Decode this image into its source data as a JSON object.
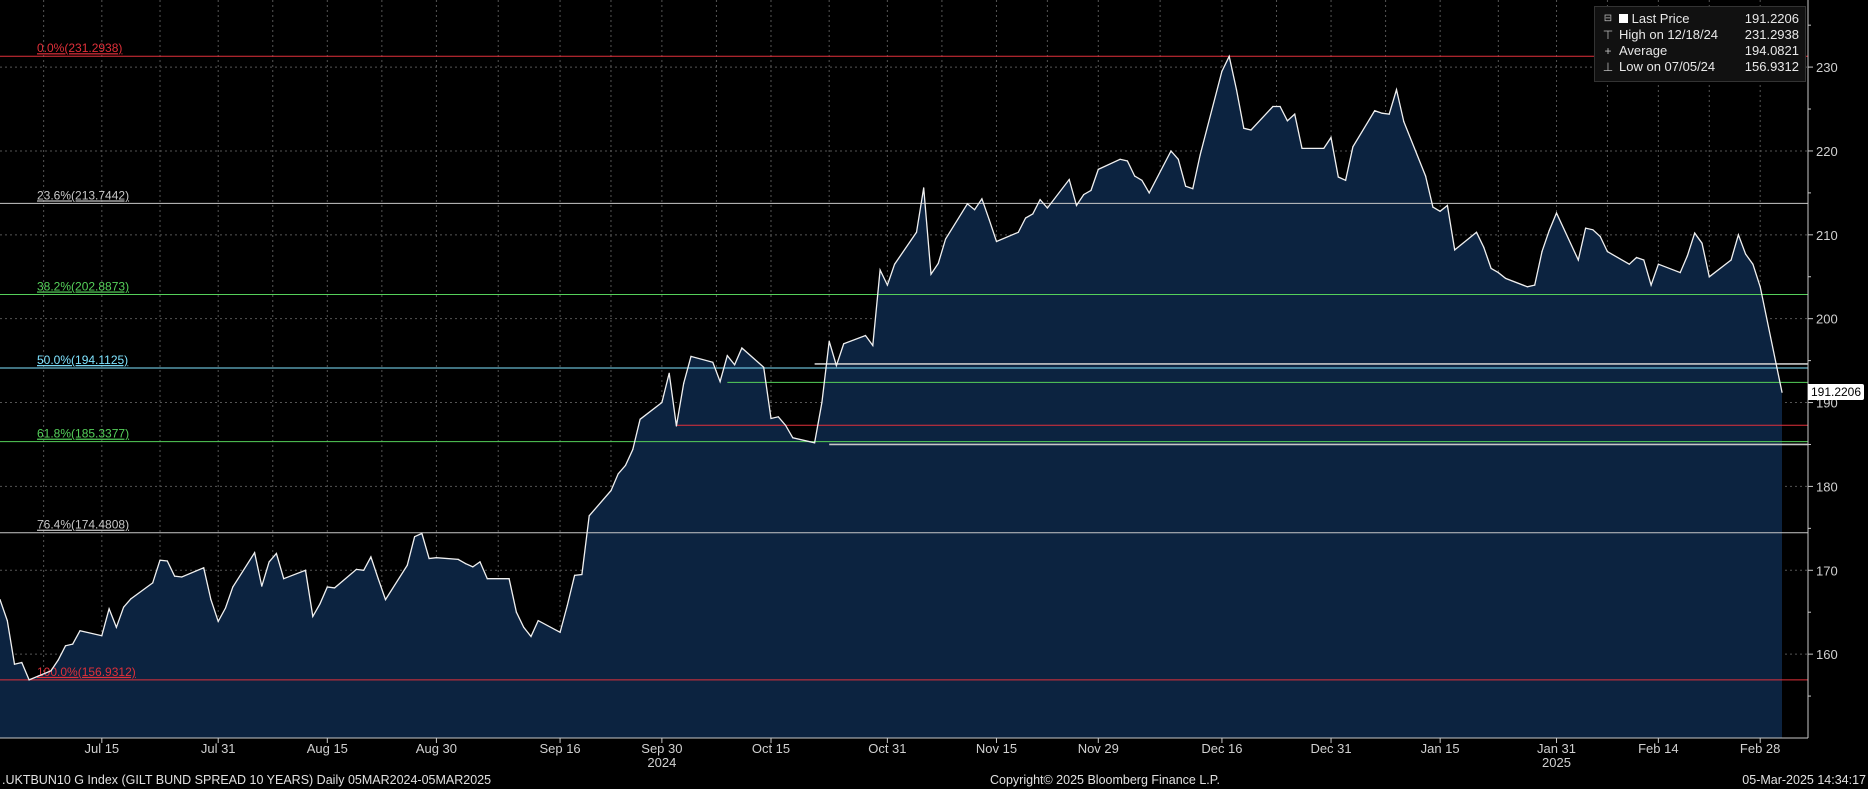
{
  "legend": {
    "items": [
      {
        "label": "Last Price",
        "value": "191.2206",
        "symbol": ""
      },
      {
        "label": "High on 12/18/24",
        "value": "231.2938",
        "symbol": "⊤"
      },
      {
        "label": "Average",
        "value": "194.0821",
        "symbol": "+"
      },
      {
        "label": "Low on 07/05/24",
        "value": "156.9312",
        "symbol": "⊥"
      }
    ]
  },
  "last_price_tag": "191.2206",
  "footer": {
    "left": ".UKTBUN10 G Index (GILT BUND SPREAD 10 YEARS)  Daily 05MAR2024-05MAR2025",
    "center": "Copyright© 2025 Bloomberg Finance L.P.",
    "right": "05-Mar-2025 14:34:17"
  },
  "colors": {
    "background": "#000000",
    "area_fill": "#0c2340",
    "line": "#ffffff",
    "grid": "#555555",
    "fib_red": "#e0303a",
    "fib_white": "#c8c8c8",
    "fib_green": "#55d05a",
    "fib_cyan": "#7fe3ff"
  },
  "chart_data": {
    "type": "area",
    "title": "",
    "xlabel": "",
    "ylabel": "",
    "ylim": [
      150,
      238
    ],
    "yticks": [
      160,
      170,
      180,
      190,
      200,
      210,
      220,
      230
    ],
    "x_ticks": [
      {
        "label": "Jul 15",
        "date": "2024-07-15"
      },
      {
        "label": "Jul 31",
        "date": "2024-07-31"
      },
      {
        "label": "Aug 15",
        "date": "2024-08-15"
      },
      {
        "label": "Aug 30",
        "date": "2024-08-30"
      },
      {
        "label": "Sep 16",
        "date": "2024-09-16"
      },
      {
        "label": "Sep 30",
        "date": "2024-09-30"
      },
      {
        "label": "Oct 15",
        "date": "2024-10-15"
      },
      {
        "label": "Oct 31",
        "date": "2024-10-31"
      },
      {
        "label": "Nov 15",
        "date": "2024-11-15"
      },
      {
        "label": "Nov 29",
        "date": "2024-11-29"
      },
      {
        "label": "Dec 16",
        "date": "2024-12-16"
      },
      {
        "label": "Dec 31",
        "date": "2024-12-31"
      },
      {
        "label": "Jan 15",
        "date": "2025-01-15"
      },
      {
        "label": "Jan 31",
        "date": "2025-01-31"
      },
      {
        "label": "Feb 14",
        "date": "2025-02-14"
      },
      {
        "label": "Feb 28",
        "date": "2025-02-28"
      }
    ],
    "year_labels": [
      {
        "label": "2024",
        "date": "2024-09-30"
      },
      {
        "label": "2025",
        "date": "2025-01-31"
      }
    ],
    "fib_levels": [
      {
        "label": "0.0%(231.2938)",
        "value": 231.2938,
        "color": "red"
      },
      {
        "label": "23.6%(213.7442)",
        "value": 213.7442,
        "color": "white"
      },
      {
        "label": "38.2%(202.8873)",
        "value": 202.8873,
        "color": "green"
      },
      {
        "label": "50.0%(194.1125)",
        "value": 194.1125,
        "color": "cyan"
      },
      {
        "label": "61.8%(185.3377)",
        "value": 185.3377,
        "color": "green"
      },
      {
        "label": "76.4%(174.4808)",
        "value": 174.4808,
        "color": "white"
      },
      {
        "label": "100.0%(156.9312)",
        "value": 156.9312,
        "color": "red"
      }
    ],
    "extra_lines": [
      {
        "value": 194.6,
        "from": "2024-10-21",
        "color": "white"
      },
      {
        "value": 192.4,
        "from": "2024-10-09",
        "color": "green"
      },
      {
        "value": 187.3,
        "from": "2024-10-02",
        "color": "red"
      },
      {
        "value": 185.0,
        "from": "2024-10-23",
        "color": "white"
      }
    ],
    "series": [
      {
        "values": [
          [
            "2024-07-01",
            166.5
          ],
          [
            "2024-07-02",
            164.0
          ],
          [
            "2024-07-03",
            158.8
          ],
          [
            "2024-07-04",
            159.0
          ],
          [
            "2024-07-05",
            156.93
          ],
          [
            "2024-07-08",
            158.0
          ],
          [
            "2024-07-09",
            159.3
          ],
          [
            "2024-07-10",
            161.0
          ],
          [
            "2024-07-11",
            161.2
          ],
          [
            "2024-07-12",
            162.8
          ],
          [
            "2024-07-15",
            162.2
          ],
          [
            "2024-07-16",
            165.4
          ],
          [
            "2024-07-17",
            163.2
          ],
          [
            "2024-07-18",
            165.6
          ],
          [
            "2024-07-19",
            166.6
          ],
          [
            "2024-07-22",
            168.5
          ],
          [
            "2024-07-23",
            171.2
          ],
          [
            "2024-07-24",
            171.1
          ],
          [
            "2024-07-25",
            169.3
          ],
          [
            "2024-07-26",
            169.2
          ],
          [
            "2024-07-29",
            170.3
          ],
          [
            "2024-07-30",
            166.5
          ],
          [
            "2024-07-31",
            163.9
          ],
          [
            "2024-08-01",
            165.5
          ],
          [
            "2024-08-02",
            168.0
          ],
          [
            "2024-08-05",
            172.1
          ],
          [
            "2024-08-06",
            168.1
          ],
          [
            "2024-08-07",
            171.0
          ],
          [
            "2024-08-08",
            172.0
          ],
          [
            "2024-08-09",
            169.0
          ],
          [
            "2024-08-12",
            170.0
          ],
          [
            "2024-08-13",
            164.5
          ],
          [
            "2024-08-14",
            166.0
          ],
          [
            "2024-08-15",
            168.0
          ],
          [
            "2024-08-16",
            167.9
          ],
          [
            "2024-08-19",
            170.1
          ],
          [
            "2024-08-20",
            170.0
          ],
          [
            "2024-08-21",
            171.6
          ],
          [
            "2024-08-22",
            169.0
          ],
          [
            "2024-08-23",
            166.5
          ],
          [
            "2024-08-26",
            170.6
          ],
          [
            "2024-08-27",
            174.0
          ],
          [
            "2024-08-28",
            174.4
          ],
          [
            "2024-08-29",
            171.4
          ],
          [
            "2024-08-30",
            171.5
          ],
          [
            "2024-09-02",
            171.3
          ],
          [
            "2024-09-03",
            170.8
          ],
          [
            "2024-09-04",
            170.4
          ],
          [
            "2024-09-05",
            171.0
          ],
          [
            "2024-09-06",
            169.0
          ],
          [
            "2024-09-09",
            169.0
          ],
          [
            "2024-09-10",
            165.0
          ],
          [
            "2024-09-11",
            163.2
          ],
          [
            "2024-09-12",
            162.1
          ],
          [
            "2024-09-13",
            164.0
          ],
          [
            "2024-09-16",
            162.6
          ],
          [
            "2024-09-17",
            165.8
          ],
          [
            "2024-09-18",
            169.4
          ],
          [
            "2024-09-19",
            169.5
          ],
          [
            "2024-09-20",
            176.5
          ],
          [
            "2024-09-23",
            179.5
          ],
          [
            "2024-09-24",
            181.5
          ],
          [
            "2024-09-25",
            182.5
          ],
          [
            "2024-09-26",
            184.4
          ],
          [
            "2024-09-27",
            188.0
          ],
          [
            "2024-09-30",
            190.0
          ],
          [
            "2024-10-01",
            193.5
          ],
          [
            "2024-10-02",
            187.2
          ],
          [
            "2024-10-03",
            192.3
          ],
          [
            "2024-10-04",
            195.5
          ],
          [
            "2024-10-07",
            194.8
          ],
          [
            "2024-10-08",
            192.5
          ],
          [
            "2024-10-09",
            195.6
          ],
          [
            "2024-10-10",
            194.5
          ],
          [
            "2024-10-11",
            196.5
          ],
          [
            "2024-10-14",
            194.2
          ],
          [
            "2024-10-15",
            188.1
          ],
          [
            "2024-10-16",
            188.3
          ],
          [
            "2024-10-17",
            187.3
          ],
          [
            "2024-10-18",
            185.8
          ],
          [
            "2024-10-21",
            185.2
          ],
          [
            "2024-10-22",
            190.0
          ],
          [
            "2024-10-23",
            197.3
          ],
          [
            "2024-10-24",
            194.4
          ],
          [
            "2024-10-25",
            197.0
          ],
          [
            "2024-10-28",
            198.0
          ],
          [
            "2024-10-29",
            196.8
          ],
          [
            "2024-10-30",
            205.8
          ],
          [
            "2024-10-31",
            204.0
          ],
          [
            "2024-11-01",
            206.5
          ],
          [
            "2024-11-04",
            210.3
          ],
          [
            "2024-11-05",
            215.6
          ],
          [
            "2024-11-06",
            205.3
          ],
          [
            "2024-11-07",
            206.6
          ],
          [
            "2024-11-08",
            209.5
          ],
          [
            "2024-11-11",
            213.7
          ],
          [
            "2024-11-12",
            213.0
          ],
          [
            "2024-11-13",
            214.3
          ],
          [
            "2024-11-14",
            211.8
          ],
          [
            "2024-11-15",
            209.2
          ],
          [
            "2024-11-18",
            210.3
          ],
          [
            "2024-11-19",
            212.0
          ],
          [
            "2024-11-20",
            212.5
          ],
          [
            "2024-11-21",
            214.2
          ],
          [
            "2024-11-22",
            213.2
          ],
          [
            "2024-11-25",
            216.6
          ],
          [
            "2024-11-26",
            213.5
          ],
          [
            "2024-11-27",
            214.8
          ],
          [
            "2024-11-28",
            215.3
          ],
          [
            "2024-11-29",
            217.8
          ],
          [
            "2024-12-02",
            219.0
          ],
          [
            "2024-12-03",
            218.8
          ],
          [
            "2024-12-04",
            217.0
          ],
          [
            "2024-12-05",
            216.5
          ],
          [
            "2024-12-06",
            215.0
          ],
          [
            "2024-12-09",
            220.0
          ],
          [
            "2024-12-10",
            219.0
          ],
          [
            "2024-12-11",
            215.8
          ],
          [
            "2024-12-12",
            215.5
          ],
          [
            "2024-12-13",
            219.5
          ],
          [
            "2024-12-16",
            229.5
          ],
          [
            "2024-12-17",
            231.29
          ],
          [
            "2024-12-18",
            227.3
          ],
          [
            "2024-12-19",
            222.7
          ],
          [
            "2024-12-20",
            222.5
          ],
          [
            "2024-12-23",
            225.3
          ],
          [
            "2024-12-24",
            225.3
          ],
          [
            "2024-12-25",
            223.6
          ],
          [
            "2024-12-26",
            224.4
          ],
          [
            "2024-12-27",
            220.3
          ],
          [
            "2024-12-30",
            220.3
          ],
          [
            "2024-12-31",
            221.6
          ],
          [
            "2025-01-01",
            216.9
          ],
          [
            "2025-01-02",
            216.5
          ],
          [
            "2025-01-03",
            220.5
          ],
          [
            "2025-01-06",
            224.8
          ],
          [
            "2025-01-07",
            224.5
          ],
          [
            "2025-01-08",
            224.4
          ],
          [
            "2025-01-09",
            227.3
          ],
          [
            "2025-01-10",
            223.5
          ],
          [
            "2025-01-13",
            217.0
          ],
          [
            "2025-01-14",
            213.3
          ],
          [
            "2025-01-15",
            212.8
          ],
          [
            "2025-01-16",
            213.5
          ],
          [
            "2025-01-17",
            208.2
          ],
          [
            "2025-01-20",
            210.3
          ],
          [
            "2025-01-21",
            208.5
          ],
          [
            "2025-01-22",
            206.0
          ],
          [
            "2025-01-23",
            205.5
          ],
          [
            "2025-01-24",
            204.8
          ],
          [
            "2025-01-27",
            203.8
          ],
          [
            "2025-01-28",
            204.0
          ],
          [
            "2025-01-29",
            208.0
          ],
          [
            "2025-01-30",
            210.5
          ],
          [
            "2025-01-31",
            212.6
          ],
          [
            "2025-02-03",
            207.0
          ],
          [
            "2025-02-04",
            210.8
          ],
          [
            "2025-02-05",
            210.6
          ],
          [
            "2025-02-06",
            209.8
          ],
          [
            "2025-02-07",
            208.0
          ],
          [
            "2025-02-10",
            206.5
          ],
          [
            "2025-02-11",
            207.3
          ],
          [
            "2025-02-12",
            207.0
          ],
          [
            "2025-02-13",
            204.0
          ],
          [
            "2025-02-14",
            206.5
          ],
          [
            "2025-02-17",
            205.5
          ],
          [
            "2025-02-18",
            207.5
          ],
          [
            "2025-02-19",
            210.2
          ],
          [
            "2025-02-20",
            209.0
          ],
          [
            "2025-02-21",
            205.0
          ],
          [
            "2025-02-24",
            207.0
          ],
          [
            "2025-02-25",
            210.0
          ],
          [
            "2025-02-26",
            207.7
          ],
          [
            "2025-02-27",
            206.5
          ],
          [
            "2025-02-28",
            203.8
          ],
          [
            "2025-03-03",
            191.22
          ]
        ]
      }
    ]
  }
}
